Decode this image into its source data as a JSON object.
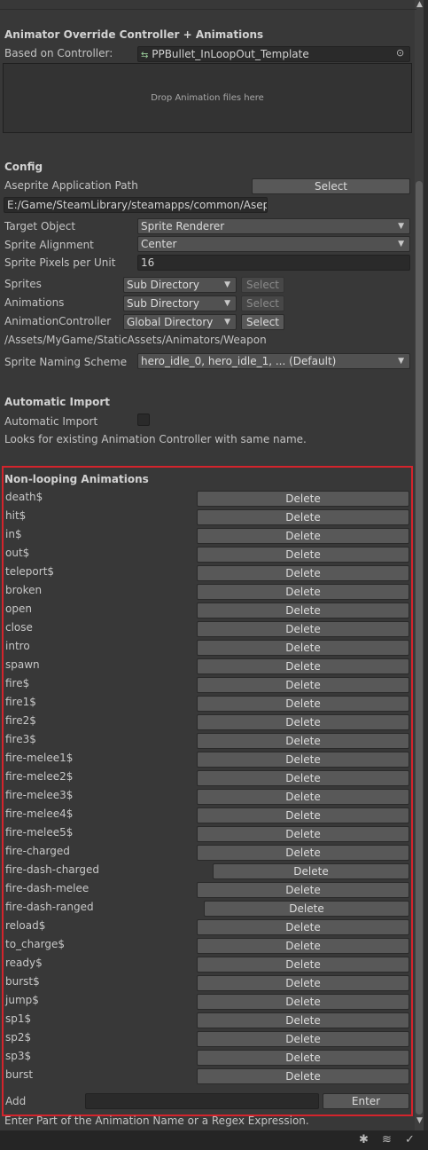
{
  "header": {
    "title": "Animator Override Controller + Animations",
    "based_on_label": "Based on Controller:",
    "based_on_value": "PPBullet_InLoopOut_Template",
    "drop_text": "Drop Animation files here"
  },
  "config": {
    "title": "Config",
    "aseprite_path_label": "Aseprite Application Path",
    "select_label": "Select",
    "aseprite_path_value": "E:/Game/SteamLibrary/steamapps/common/Aseprite,",
    "target_object_label": "Target Object",
    "target_object_value": "Sprite Renderer",
    "sprite_alignment_label": "Sprite Alignment",
    "sprite_alignment_value": "Center",
    "ppu_label": "Sprite Pixels per Unit",
    "ppu_value": "16",
    "sprites_label": "Sprites",
    "sprites_value": "Sub Directory",
    "animations_label": "Animations",
    "animations_value": "Sub Directory",
    "controller_label": "AnimationController",
    "controller_value": "Global Directory",
    "controller_path": "/Assets/MyGame/StaticAssets/Animators/Weapon",
    "naming_label": "Sprite Naming Scheme",
    "naming_value": "hero_idle_0, hero_idle_1, ... (Default)"
  },
  "auto_import": {
    "title": "Automatic Import",
    "toggle_label": "Automatic Import",
    "checked": false,
    "info": "Looks for existing Animation Controller with same name."
  },
  "nonlooping": {
    "title": "Non-looping Animations",
    "delete_label": "Delete",
    "items": [
      "death$",
      "hit$",
      "in$",
      "out$",
      "teleport$",
      "broken",
      "open",
      "close",
      "intro",
      "spawn",
      "fire$",
      "fire1$",
      "fire2$",
      "fire3$",
      "fire-melee1$",
      "fire-melee2$",
      "fire-melee3$",
      "fire-melee4$",
      "fire-melee5$",
      "fire-charged",
      "fire-dash-charged",
      "fire-dash-melee",
      "fire-dash-ranged",
      "reload$",
      "to_charge$",
      "ready$",
      "burst$",
      "jump$",
      "sp1$",
      "sp2$",
      "sp3$",
      "burst"
    ],
    "add_label": "Add",
    "add_value": "",
    "enter_label": "Enter",
    "hint": "Enter Part of the Animation Name or a Regex Expression."
  }
}
